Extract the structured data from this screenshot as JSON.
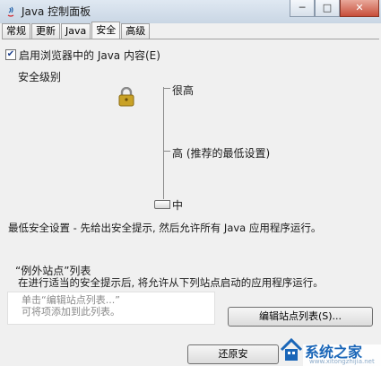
{
  "window": {
    "title": "Java 控制面板",
    "minimize": "─",
    "maximize": "□",
    "close": "✕"
  },
  "tabs": [
    {
      "label": "常规"
    },
    {
      "label": "更新"
    },
    {
      "label": "Java"
    },
    {
      "label": "安全"
    },
    {
      "label": "高级"
    }
  ],
  "security": {
    "enable_java": {
      "label": "启用浏览器中的 Java 内容(E)",
      "checked": true,
      "mark": "✔"
    },
    "level_heading": "安全级别",
    "level_very_high": "很高",
    "level_high": "高 (推荐的最低设置)",
    "level_medium": "中",
    "current_level": "中",
    "description": "最低安全设置 - 先给出安全提示, 然后允许所有 Java 应用程序运行。"
  },
  "exception_sites": {
    "heading": "“例外站点”列表",
    "description": "在进行适当的安全提示后, 将允许从下列站点启动的应用程序运行。",
    "placeholder_line1": "单击“编辑站点列表...”",
    "placeholder_line2": "可将项添加到此列表。",
    "edit_button": "编辑站点列表(S)..."
  },
  "restore_button": "还原安",
  "watermark": {
    "text": "系统之家",
    "sub": "www.xitongzhijia.net"
  },
  "colors": {
    "accent": "#1a66b8",
    "close": "#c74e3a",
    "lock": "#c9a227"
  }
}
